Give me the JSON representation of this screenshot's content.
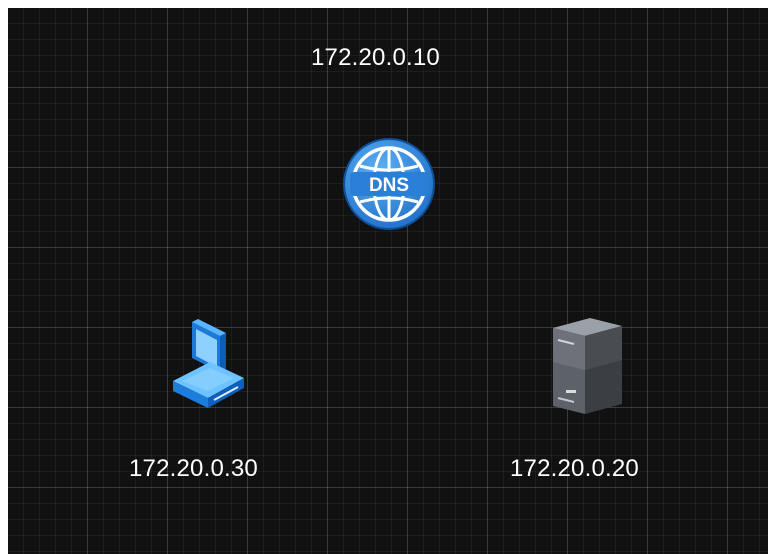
{
  "diagram": {
    "nodes": [
      {
        "id": "dns",
        "icon": "dns-globe-icon",
        "ip": "172.20.0.10"
      },
      {
        "id": "client",
        "icon": "desktop-computer-icon",
        "ip": "172.20.0.30"
      },
      {
        "id": "server",
        "icon": "server-tower-icon",
        "ip": "172.20.0.20"
      }
    ],
    "dns_badge": "DNS"
  },
  "colors": {
    "canvas_background": "#111111",
    "grid_line": "#2f2f2f",
    "label_text": "#ffffff",
    "dns_blue": "#2f8be0",
    "pc_blue": "#2f9bf0",
    "server_gray": "#4a4d52"
  }
}
